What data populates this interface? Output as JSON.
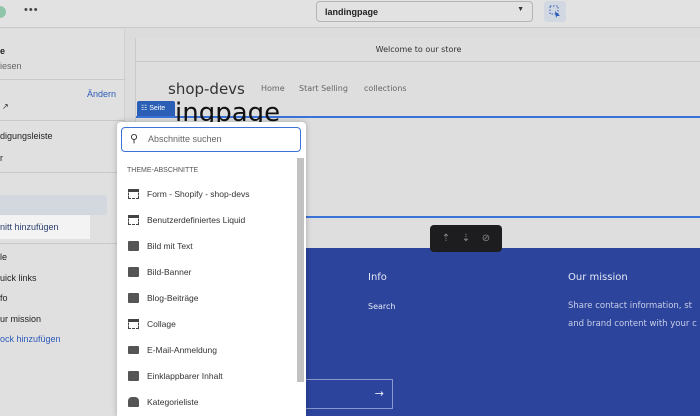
{
  "topbar": {
    "more_label": "•••",
    "page_select": "landingpage"
  },
  "sidebar": {
    "items": [
      "e",
      "iesen",
      "Ändern",
      "digungsleiste",
      "r",
      "nitt hinzufügen",
      "le",
      "uick links",
      "fo",
      "ur mission",
      "ock hinzufügen"
    ]
  },
  "preview": {
    "announcement": "Welcome to our store",
    "logo": "shop-devs",
    "nav": [
      "Home",
      "Start Selling",
      "collections"
    ],
    "section_tag": "Seite",
    "page_title": "ingpage",
    "footer": {
      "info_heading": "Info",
      "info_link": "Search",
      "mission_heading": "Our mission",
      "mission_text1": "Share contact information, st",
      "mission_text2": "and brand content with your c",
      "arrow": "→"
    }
  },
  "popover": {
    "search_placeholder": "Abschnitte suchen",
    "group": "THEME-ABSCHNITTE",
    "items": [
      {
        "label": "Form - Shopify - shop-devs",
        "icon": "dashed"
      },
      {
        "label": "Benutzerdefiniertes Liquid",
        "icon": "dashed"
      },
      {
        "label": "Bild mit Text",
        "icon": "text"
      },
      {
        "label": "Bild-Banner",
        "icon": "image"
      },
      {
        "label": "Blog-Beiträge",
        "icon": "blog"
      },
      {
        "label": "Collage",
        "icon": "dashed"
      },
      {
        "label": "E-Mail-Anmeldung",
        "icon": "mail"
      },
      {
        "label": "Einklappbarer Inhalt",
        "icon": "text"
      },
      {
        "label": "Kategorieliste",
        "icon": "tag"
      }
    ]
  }
}
